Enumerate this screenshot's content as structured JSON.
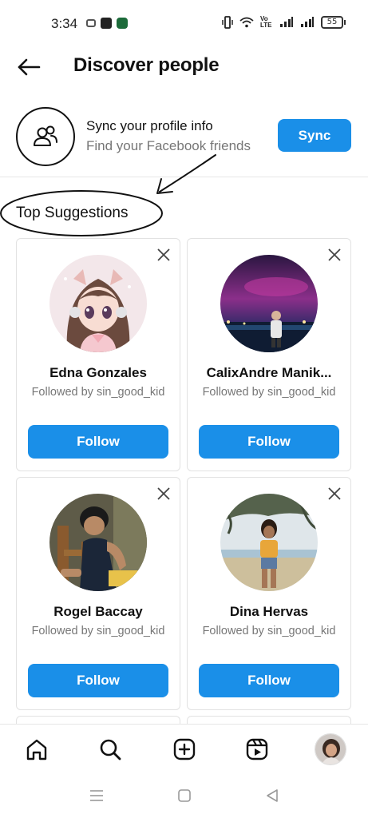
{
  "status_bar": {
    "time": "3:34",
    "battery": "55",
    "volte_label": "Vo LTE"
  },
  "header": {
    "title": "Discover people",
    "back_icon": "arrow-left-icon"
  },
  "sync": {
    "title": "Sync your profile info",
    "subtitle": "Find your Facebook friends",
    "button_label": "Sync",
    "icon": "people-icon"
  },
  "section": {
    "title": "Top Suggestions"
  },
  "suggestions": [
    {
      "name": "Edna Gonzales",
      "followed_by": "Followed by sin_good_kid",
      "follow_label": "Follow"
    },
    {
      "name": "CalixAndre Manik...",
      "followed_by": "Followed by sin_good_kid",
      "follow_label": "Follow"
    },
    {
      "name": "Rogel Baccay",
      "followed_by": "Followed by sin_good_kid",
      "follow_label": "Follow"
    },
    {
      "name": "Dina Hervas",
      "followed_by": "Followed by sin_good_kid",
      "follow_label": "Follow"
    }
  ],
  "bottom_nav": {
    "items": [
      "home-icon",
      "search-icon",
      "create-icon",
      "reels-icon",
      "profile-avatar"
    ]
  },
  "system_nav": {
    "items": [
      "menu-icon",
      "home-square-icon",
      "back-triangle-icon"
    ]
  },
  "colors": {
    "accent": "#1a8fe8",
    "text": "#111111",
    "secondary_text": "#777777",
    "border": "#e2e2e2"
  }
}
